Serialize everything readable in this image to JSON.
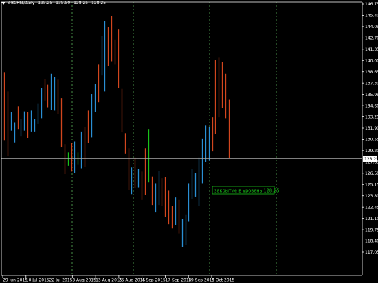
{
  "header": {
    "symbol": "#BCHN,Daily",
    "open": "135.25",
    "high": "135.50",
    "low": "128.25",
    "close": "128.25"
  },
  "price_axis": {
    "ticks": [
      "146.75",
      "145.40",
      "144.05",
      "142.70",
      "141.35",
      "140.00",
      "138.65",
      "137.30",
      "135.95",
      "134.60",
      "133.25",
      "131.90",
      "130.55",
      "129.20",
      "127.85",
      "126.50",
      "125.15",
      "123.80",
      "122.45",
      "121.10",
      "119.75",
      "118.40",
      "117.05"
    ],
    "current_price_label": "128.25"
  },
  "time_axis": {
    "labels": [
      "29 Jun 2015",
      "10 Jul 2015",
      "22 Jul 2015",
      "3 Aug 2015",
      "13 Aug 2015",
      "25 Aug 2015",
      "4 Sep 2015",
      "17 Sep 2015",
      "29 Sep 2015",
      "9 Oct 2015"
    ]
  },
  "annotation": {
    "text": "закрытие в уровень 128.25"
  },
  "colors": {
    "background": "#000000",
    "axis": "#ffffff",
    "bull_bar": "#2a8fd4",
    "bear_bar": "#d2461e",
    "signal_bar": "#19c219",
    "grid_dash": "#5ab35a",
    "horizontal_line": "#aaaaaa",
    "annotation": "#19c219"
  },
  "chart_data": {
    "type": "ohlc-bars",
    "price_levels": {
      "current": 128.25
    },
    "dates": [
      "29 Jun 2015",
      "10 Jul 2015",
      "22 Jul 2015",
      "3 Aug 2015",
      "13 Aug 2015",
      "25 Aug 2015",
      "4 Sep 2015",
      "17 Sep 2015",
      "29 Sep 2015",
      "9 Oct 2015"
    ],
    "bars": [
      {
        "h": 138.6,
        "l": 130.4,
        "c": "bear"
      },
      {
        "h": 136.3,
        "l": 128.6,
        "c": "bear"
      },
      {
        "h": 133.8,
        "l": 131.6,
        "c": "bull"
      },
      {
        "h": 132.6,
        "l": 130.2,
        "c": "bull"
      },
      {
        "h": 134.5,
        "l": 131.8,
        "c": "bear"
      },
      {
        "h": 133.0,
        "l": 130.9,
        "c": "bull"
      },
      {
        "h": 133.9,
        "l": 131.6,
        "c": "bull"
      },
      {
        "h": 133.8,
        "l": 130.7,
        "c": "bear"
      },
      {
        "h": 134.0,
        "l": 131.5,
        "c": "bull"
      },
      {
        "h": 133.0,
        "l": 131.5,
        "c": "bull"
      },
      {
        "h": 134.8,
        "l": 132.4,
        "c": "bull"
      },
      {
        "h": 136.7,
        "l": 133.1,
        "c": "bull"
      },
      {
        "h": 137.8,
        "l": 135.2,
        "c": "bear"
      },
      {
        "h": 137.1,
        "l": 134.4,
        "c": "bear"
      },
      {
        "h": 138.4,
        "l": 134.1,
        "c": "bull"
      },
      {
        "h": 138.0,
        "l": 134.0,
        "c": "bull"
      },
      {
        "h": 137.7,
        "l": 133.6,
        "c": "bear"
      },
      {
        "h": 135.5,
        "l": 129.6,
        "c": "bear"
      },
      {
        "h": 130.0,
        "l": 126.4,
        "c": "bear"
      },
      {
        "h": 129.0,
        "l": 127.4,
        "c": "signal"
      },
      {
        "h": 130.1,
        "l": 126.7,
        "c": "bear"
      },
      {
        "h": 130.3,
        "l": 126.5,
        "c": "bull"
      },
      {
        "h": 129.0,
        "l": 127.5,
        "c": "signal"
      },
      {
        "h": 131.5,
        "l": 127.1,
        "c": "bull"
      },
      {
        "h": 132.0,
        "l": 127.3,
        "c": "bear"
      },
      {
        "h": 134.0,
        "l": 130.1,
        "c": "bear"
      },
      {
        "h": 136.0,
        "l": 130.8,
        "c": "bull"
      },
      {
        "h": 137.2,
        "l": 133.8,
        "c": "bull"
      },
      {
        "h": 139.5,
        "l": 135.0,
        "c": "bear"
      },
      {
        "h": 142.9,
        "l": 138.2,
        "c": "bull"
      },
      {
        "h": 144.7,
        "l": 136.3,
        "c": "bull"
      },
      {
        "h": 144.0,
        "l": 139.3,
        "c": "bear"
      },
      {
        "h": 145.3,
        "l": 139.9,
        "c": "bear"
      },
      {
        "h": 142.5,
        "l": 139.5,
        "c": "bear"
      },
      {
        "h": 143.7,
        "l": 136.7,
        "c": "bear"
      },
      {
        "h": 136.6,
        "l": 131.4,
        "c": "bear"
      },
      {
        "h": 131.3,
        "l": 128.8,
        "c": "bear"
      },
      {
        "h": 129.5,
        "l": 124.5,
        "c": "bear"
      },
      {
        "h": 127.2,
        "l": 124.0,
        "c": "bull"
      },
      {
        "h": 128.4,
        "l": 124.7,
        "c": "bear"
      },
      {
        "h": 127.0,
        "l": 124.8,
        "c": "bull"
      },
      {
        "h": 126.7,
        "l": 123.3,
        "c": "bear"
      },
      {
        "h": 129.5,
        "l": 123.9,
        "c": "bear"
      },
      {
        "h": 131.8,
        "l": 125.4,
        "c": "signal"
      },
      {
        "h": 126.1,
        "l": 122.7,
        "c": "bear"
      },
      {
        "h": 125.3,
        "l": 121.8,
        "c": "bull"
      },
      {
        "h": 126.8,
        "l": 122.7,
        "c": "bull"
      },
      {
        "h": 125.9,
        "l": 122.6,
        "c": "bear"
      },
      {
        "h": 126.0,
        "l": 121.3,
        "c": "bear"
      },
      {
        "h": 124.4,
        "l": 120.4,
        "c": "bear"
      },
      {
        "h": 122.6,
        "l": 119.9,
        "c": "bear"
      },
      {
        "h": 123.6,
        "l": 120.3,
        "c": "bull"
      },
      {
        "h": 123.3,
        "l": 119.3,
        "c": "bear"
      },
      {
        "h": 121.0,
        "l": 117.7,
        "c": "bull"
      },
      {
        "h": 121.5,
        "l": 117.9,
        "c": "bull"
      },
      {
        "h": 125.3,
        "l": 120.7,
        "c": "bull"
      },
      {
        "h": 127.0,
        "l": 123.4,
        "c": "bull"
      },
      {
        "h": 126.5,
        "l": 123.7,
        "c": "bull"
      },
      {
        "h": 128.4,
        "l": 122.6,
        "c": "bull"
      },
      {
        "h": 130.6,
        "l": 125.3,
        "c": "bull"
      },
      {
        "h": 132.2,
        "l": 127.8,
        "c": "bull"
      },
      {
        "h": 132.0,
        "l": 128.0,
        "c": "bull"
      },
      {
        "h": 133.2,
        "l": 129.1,
        "c": "bear"
      },
      {
        "h": 140.1,
        "l": 131.2,
        "c": "bear"
      },
      {
        "h": 140.4,
        "l": 133.2,
        "c": "bear"
      },
      {
        "h": 139.8,
        "l": 134.3,
        "c": "bear"
      },
      {
        "h": 138.4,
        "l": 133.1,
        "c": "bear"
      },
      {
        "h": 135.3,
        "l": 128.3,
        "c": "bear"
      }
    ]
  }
}
